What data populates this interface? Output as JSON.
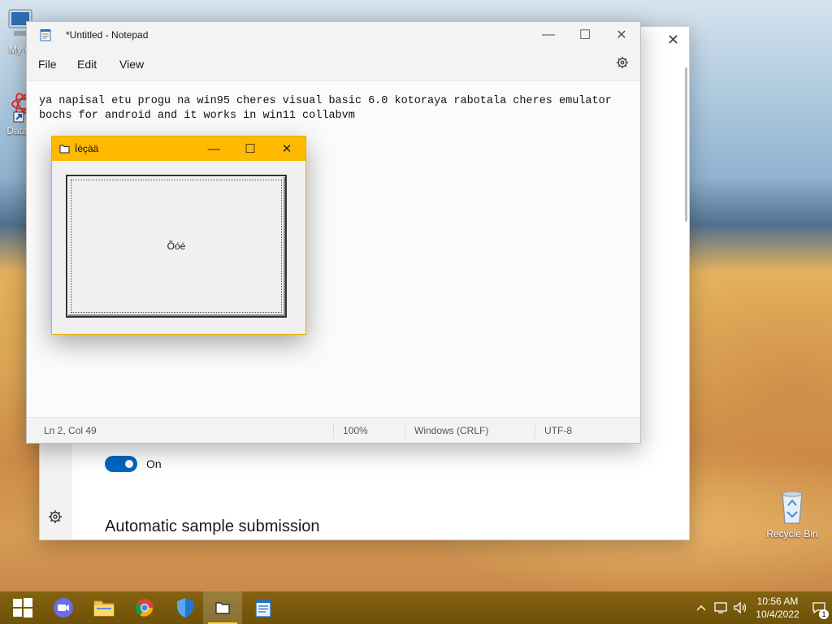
{
  "desktop": {
    "icons": [
      {
        "label": "My C"
      },
      {
        "label": "DataV"
      },
      {
        "label": "Recycle Bin"
      }
    ]
  },
  "settings": {
    "toggle_label": "On",
    "section_heading": "Automatic sample submission"
  },
  "notepad": {
    "title": "*Untitled - Notepad",
    "menu": [
      "File",
      "Edit",
      "View"
    ],
    "content": "ya napisal etu progu na win95 cheres visual basic 6.0 kotoraya rabotala cheres emulator\nbochs for android and it works in win11 collabvm",
    "status": {
      "position": "Ln 2, Col 49",
      "zoom": "100%",
      "line_ending": "Windows (CRLF)",
      "encoding": "UTF-8"
    }
  },
  "vb_window": {
    "title": "Ìèçàä",
    "button_label": "Õóé"
  },
  "taskbar": {
    "clock_time": "10:56 AM",
    "clock_date": "10/4/2022",
    "notification_count": "1"
  },
  "colors": {
    "vb_titlebar": "#ffb900",
    "taskbar": "#7a5a0a",
    "toggle_on": "#0067c0"
  }
}
